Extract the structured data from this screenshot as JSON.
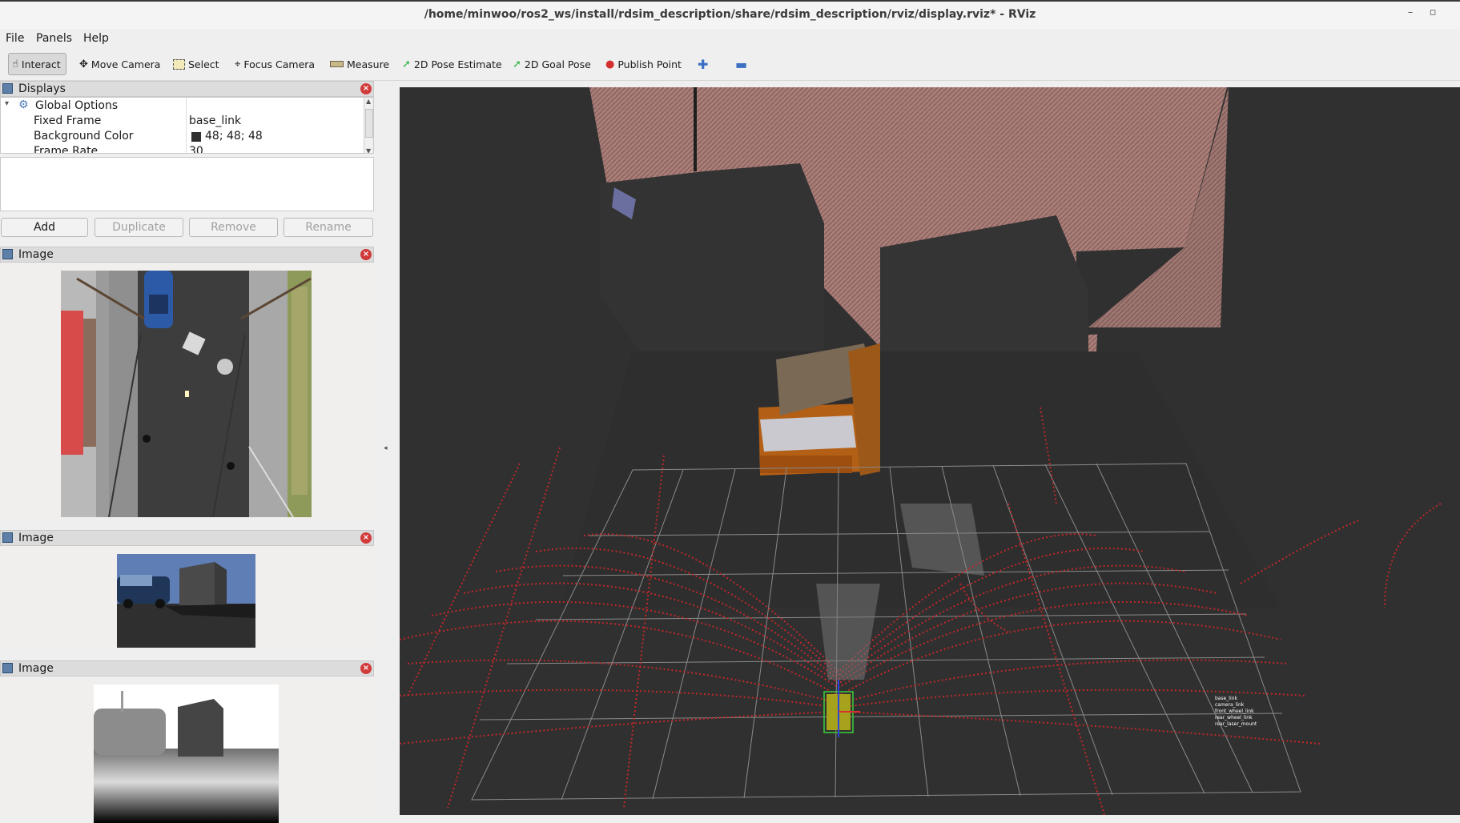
{
  "window": {
    "title": "/home/minwoo/ros2_ws/install/rdsim_description/share/rdsim_description/rviz/display.rviz* - RViz",
    "controls": [
      "–",
      "▫"
    ]
  },
  "menu": [
    {
      "label": "File"
    },
    {
      "label": "Panels"
    },
    {
      "label": "Help"
    }
  ],
  "toolbar": {
    "interact": "Interact",
    "move_camera": "Move Camera",
    "select": "Select",
    "focus_camera": "Focus Camera",
    "measure": "Measure",
    "pose_estimate": "2D Pose Estimate",
    "goal_pose": "2D Goal Pose",
    "publish_point": "Publish Point"
  },
  "displays": {
    "title": "Displays",
    "global_options": "Global Options",
    "props": [
      {
        "name": "Fixed Frame",
        "value": "base_link"
      },
      {
        "name": "Background Color",
        "value": "48; 48; 48"
      },
      {
        "name": "Frame Rate",
        "value": "30"
      }
    ],
    "buttons": {
      "add": "Add",
      "duplicate": "Duplicate",
      "remove": "Remove",
      "rename": "Rename"
    }
  },
  "image_panels": [
    {
      "title": "Image"
    },
    {
      "title": "Image"
    },
    {
      "title": "Image"
    }
  ],
  "colors": {
    "background": "#303030",
    "laser": "#c0282a",
    "grid": "#8a8a8a"
  },
  "robot_labels": [
    "base_link",
    "camera_link",
    "front_wheel_link",
    "rear_wheel_link",
    "rear_laser_mount"
  ]
}
